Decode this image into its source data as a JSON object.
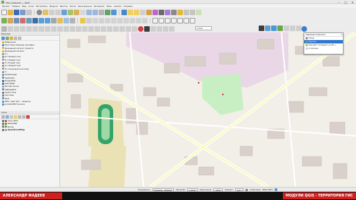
{
  "window": {
    "title": "*Без названия — QGIS",
    "controls": [
      "–",
      "□",
      "✕"
    ]
  },
  "menu": [
    "Проект",
    "Правка",
    "Вид",
    "Слой",
    "Настройки",
    "Модули",
    "Вектор",
    "Растр",
    "База данных",
    "Интернет",
    "Меш",
    "Анализ",
    "Справка"
  ],
  "browser_panel": {
    "title": "Браузер",
    "items": [
      {
        "label": "Избранное",
        "icon": "star-icon",
        "color": "#e7b416"
      },
      {
        "label": "Пространственные закладки",
        "icon": "bookmark-icon",
        "color": "#5c8ac7"
      },
      {
        "label": "Домашний каталог проекта",
        "icon": "folder-icon",
        "color": "#e0b33c"
      },
      {
        "label": "Домашний каталог",
        "icon": "folder-icon",
        "color": "#e0b33c"
      },
      {
        "label": "C:\\",
        "icon": "drive-icon",
        "color": "#9a9a9a"
      },
      {
        "label": "D:\\ (Новый том)",
        "icon": "drive-icon",
        "color": "#9a9a9a"
      },
      {
        "label": "E:\\ (Новый том)",
        "icon": "drive-icon",
        "color": "#9a9a9a"
      },
      {
        "label": "F:\\ (Новый том)",
        "icon": "drive-icon",
        "color": "#9a9a9a"
      },
      {
        "label": "G:\\ (Новый том)",
        "icon": "drive-icon",
        "color": "#9a9a9a"
      },
      {
        "label": "H:\\ (Съемный носитель)",
        "icon": "drive-icon",
        "color": "#9a9a9a"
      },
      {
        "label": "I:\\",
        "icon": "drive-icon",
        "color": "#9a9a9a"
      },
      {
        "label": "GeoPackage",
        "icon": "geopackage-icon",
        "color": "#5aa0d6"
      },
      {
        "label": "SpatiaLite",
        "icon": "spatialite-icon",
        "color": "#5f8fbf"
      },
      {
        "label": "PostgreSQL",
        "icon": "postgresql-icon",
        "color": "#3e6e9f"
      },
      {
        "label": "SAP HANA",
        "icon": "database-icon",
        "color": "#3d7cc9"
      },
      {
        "label": "MS SQL Server",
        "icon": "database-icon",
        "color": "#a0a0a0"
      },
      {
        "label": "WMS/WMTS",
        "icon": "globe-icon",
        "color": "#4b9ad2"
      },
      {
        "label": "Vector Tiles",
        "icon": "grid-icon",
        "color": "#7d7d7d"
      },
      {
        "label": "XYZ Tiles",
        "icon": "grid-icon",
        "color": "#7d7d7d"
      },
      {
        "label": "WCS",
        "icon": "globe-icon",
        "color": "#4b9ad2"
      },
      {
        "label": "WFS / OGC API — объекты",
        "icon": "globe-icon",
        "color": "#4b9ad2"
      },
      {
        "label": "ArcGIS REST Servers",
        "icon": "globe-icon",
        "color": "#4b9ad2"
      }
    ]
  },
  "layers_panel": {
    "title": "Слои",
    "items": [
      {
        "label": "Зона_WGS",
        "checked": true,
        "color": "#c64a4a"
      },
      {
        "label": "ВЛАСОВА",
        "checked": true,
        "color": "#6b9e3c"
      },
      {
        "label": "Вопль",
        "checked": true,
        "color": "#6b9e3c"
      },
      {
        "label": "OpenStreetMap",
        "checked": true,
        "color": "#8aa9c8",
        "bold": true
      }
    ]
  },
  "dropdown": {
    "header": "Заданные подложки",
    "items": [
      {
        "label": "Улица",
        "color": "#8e7cc3",
        "selected": false
      },
      {
        "label": "Спутник",
        "color": "#6aa84f",
        "selected": true
      },
      {
        "label": "Ланшафт (Стандарт на OP...)",
        "color": "#93c47d",
        "selected": false
      },
      {
        "label": "О плагине",
        "color": "#cccccc",
        "selected": false
      }
    ]
  },
  "combo_scale": "1:1мм",
  "statusbar": {
    "coord_label": "Координаты",
    "coord_value": "5430441, 7629947",
    "scale_label": "Масштаб",
    "scale_value": "1:2307",
    "magnifier_label": "Увеличение",
    "magnifier_value": "100%",
    "rotation_label": "Поворот",
    "rotation_value": "0,0 °",
    "render_label": "Отрисовка",
    "crs": "EPSG:3857"
  },
  "captions": {
    "left": "АЛЕКСАНДР ФАДЕЕВ",
    "right": "МОДУЛИ QGIS - ТЕРРИТОРИЯ ГИС"
  },
  "colors": {
    "accent": "#d01f1f",
    "map_bg": "#f2efe9",
    "building": "#d9d0c9",
    "green": "#c8efc4",
    "pink": "#e9d7e7",
    "road": "#ffffff",
    "major_road": "#f7fabf"
  }
}
